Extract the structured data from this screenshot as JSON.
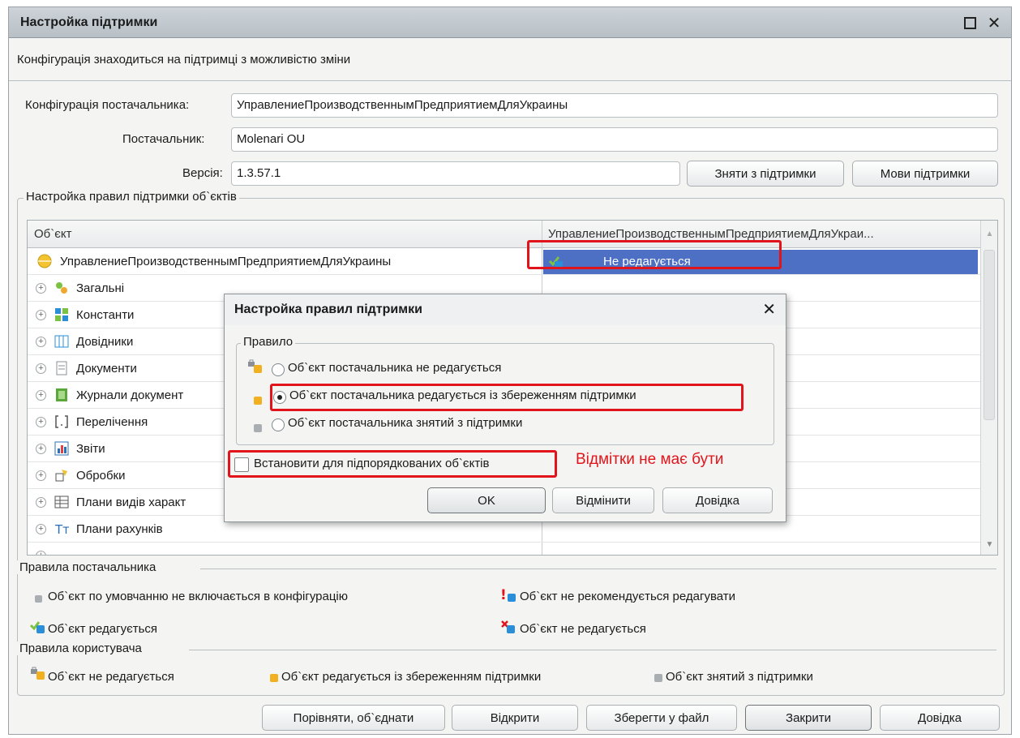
{
  "window": {
    "title": "Настройка підтримки"
  },
  "info_line": "Конфігурація знаходиться на підтримці з можливістю зміни",
  "fields": {
    "vendor_config_label": "Конфігурація постачальника:",
    "vendor_config_value": "УправлениеПроизводственнымПредприятиемДляУкраины",
    "vendor_label": "Постачальник:",
    "vendor_value": "Molenari OU",
    "version_label": "Версія:",
    "version_value": "1.3.57.1"
  },
  "buttons_top": {
    "remove_support": "Зняти з підтримки",
    "support_languages": "Мови підтримки"
  },
  "rules_group_title": "Настройка правил підтримки об`єктів",
  "tree": {
    "col_object": "Об`єкт",
    "col_config": "УправлениеПроизводственнымПредприятиемДляУкраи...",
    "root_label": "УправлениеПроизводственнымПредприятиемДляУкраины",
    "root_value": "Не редагується",
    "rows": [
      "Загальні",
      "Константи",
      "Довідники",
      "Документи",
      "Журнали документ",
      "Перелічення",
      "Звіти",
      "Обробки",
      "Плани видів характ",
      "Плани рахунків"
    ]
  },
  "vendor_rules": {
    "title": "Правила постачальника",
    "items": [
      "Об`єкт по умовчанню не включається в конфігурацію",
      "Об`єкт не рекомендується редагувати",
      "Об`єкт редагується",
      "Об`єкт не редагується"
    ]
  },
  "user_rules": {
    "title": "Правила користувача",
    "items": [
      "Об`єкт не редагується",
      "Об`єкт редагується із збереженням підтримки",
      "Об`єкт знятий з підтримки"
    ]
  },
  "bottom_buttons": {
    "compare": "Порівняти, об`єднати",
    "open": "Відкрити",
    "save": "Зберегти у файл",
    "close": "Закрити",
    "help": "Довідка"
  },
  "dialog": {
    "title": "Настройка правил підтримки",
    "group_title": "Правило",
    "options": [
      "Об`єкт постачальника не редагується",
      "Об`єкт постачальника редагується із збереженням підтримки",
      "Об`єкт постачальника знятий з підтримки"
    ],
    "selected_option": 1,
    "checkbox_label": "Встановити для підпорядкованих об`єктів",
    "ok": "OK",
    "cancel": "Відмінити",
    "help": "Довідка"
  },
  "annotation": "Відмітки не має бути",
  "colors": {
    "accent_red": "#e2141b",
    "selection_blue": "#4d6fc4"
  }
}
